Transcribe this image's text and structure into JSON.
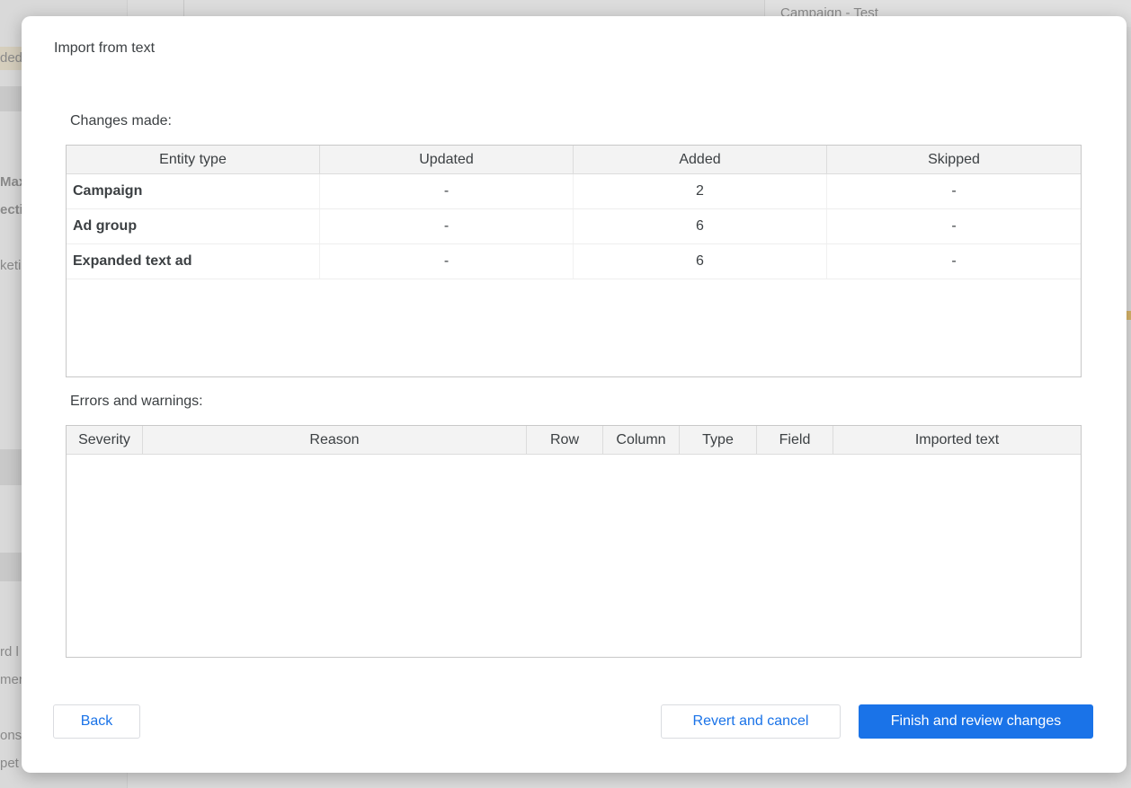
{
  "background": {
    "top_right_label": "Campaign - Test",
    "left_fragments": [
      "ded",
      "Max",
      "ecti",
      "keti",
      "rd l",
      "men",
      "ons",
      "pet"
    ]
  },
  "dialog": {
    "title": "Import from text",
    "changes": {
      "label": "Changes made:",
      "columns": [
        "Entity type",
        "Updated",
        "Added",
        "Skipped"
      ],
      "rows": [
        [
          "Campaign",
          "-",
          "2",
          "-"
        ],
        [
          "Ad group",
          "-",
          "6",
          "-"
        ],
        [
          "Expanded text ad",
          "-",
          "6",
          "-"
        ]
      ]
    },
    "errors": {
      "label": "Errors and warnings:",
      "columns": [
        "Severity",
        "Reason",
        "Row",
        "Column",
        "Type",
        "Field",
        "Imported text"
      ]
    },
    "buttons": {
      "back": "Back",
      "revert": "Revert and cancel",
      "finish": "Finish and review changes"
    }
  },
  "colors": {
    "accent": "#1a73e8",
    "text": "#3c4043",
    "header_bg": "#f3f3f3"
  }
}
